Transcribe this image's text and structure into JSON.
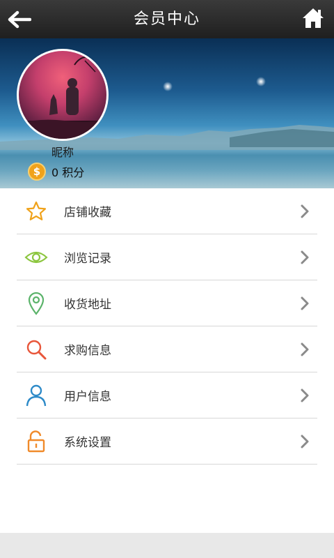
{
  "header": {
    "title": "会员中心"
  },
  "profile": {
    "nickname": "昵称",
    "points_text": "0 积分",
    "coin_symbol": "$"
  },
  "menu": {
    "items": [
      {
        "label": "店铺收藏",
        "icon": "star-icon",
        "color": "#f0a21a"
      },
      {
        "label": "浏览记录",
        "icon": "eye-icon",
        "color": "#8cc63f"
      },
      {
        "label": "收货地址",
        "icon": "location-pin-icon",
        "color": "#5bb36a"
      },
      {
        "label": "求购信息",
        "icon": "search-icon",
        "color": "#e8563a"
      },
      {
        "label": "用户信息",
        "icon": "user-icon",
        "color": "#2d8ac8"
      },
      {
        "label": "系统设置",
        "icon": "lock-icon",
        "color": "#f08a2a"
      }
    ]
  }
}
